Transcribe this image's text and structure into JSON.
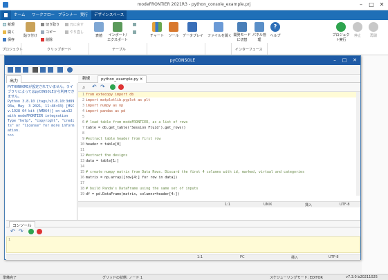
{
  "window": {
    "title": "modeFRONTIER 2021R3 - python_console_example.prj"
  },
  "ribbon_tabs": [
    "ホーム",
    "ワークフロー",
    "プランナー",
    "実行",
    "デザインスペース"
  ],
  "ribbon": {
    "project": {
      "new": "新規",
      "open": "開く",
      "save": "保存",
      "group": "プロジェクト"
    },
    "clipboard": {
      "paste": "貼り付け",
      "cut": "切り取り",
      "copy": "コピー",
      "remove": "削除",
      "undo": "元に戻す",
      "redo": "やり直し",
      "group": "クリップボード"
    },
    "table": {
      "table": "表値",
      "import": "インポート/エクスポート",
      "group": "テーブル"
    },
    "chart": "チャート",
    "tool": "ツール",
    "dataplay": "データプレイ",
    "fileopen": "ファイルを開く",
    "interface": {
      "switch": "開発モードに切替",
      "panel": "パネル管理",
      "group": "インターフェース"
    },
    "help": "ヘルプ",
    "run": "プロジェクト実行",
    "stop": "停止",
    "resume": "再開"
  },
  "dialog": {
    "title": "pyCONSOLE",
    "output_tab": "出力",
    "output_text": "PYTHONHOMEが設定されていません。ライブラリによってはpyCONSOLEから利用できません。\nPython 3.8.10 (tags/v3.8.10:3d8993a, May  3 2021, 11:48:03) [MSC v.1928 64 bit (AMD64)] on win32 with modeFRONTIER integration\nType \"help\", \"copyright\", \"credits\" or \"license\" for more information.\n>>>",
    "editor_tabs": [
      "新規",
      "python_example.py"
    ],
    "code_lines": [
      {
        "n": "1",
        "t": "from extecopy import db"
      },
      {
        "n": "2",
        "t": "import matplotlib.pyplot as plt"
      },
      {
        "n": "3",
        "t": "import numpy as np"
      },
      {
        "n": "4",
        "t": "import pandas as pd"
      },
      {
        "n": "5",
        "t": ""
      },
      {
        "n": "6",
        "t": "# load table from modeFRONTIER, as a list of rows"
      },
      {
        "n": "7",
        "t": "table = db.get_table('Session Fluid').get_rows()"
      },
      {
        "n": "8",
        "t": ""
      },
      {
        "n": "9",
        "t": "#extract table header from first row"
      },
      {
        "n": "10",
        "t": "header = table[0]"
      },
      {
        "n": "11",
        "t": ""
      },
      {
        "n": "12",
        "t": "#extract the designs"
      },
      {
        "n": "13",
        "t": "data = table[1:]"
      },
      {
        "n": "14",
        "t": ""
      },
      {
        "n": "15",
        "t": "# create numpy matrix from Data Rows. Discard the first 4 columns with id, marked, virtual and categories"
      },
      {
        "n": "16",
        "t": "matrix = np.array([row[4:] for row in data])"
      },
      {
        "n": "17",
        "t": ""
      },
      {
        "n": "18",
        "t": "# build Panda's DataFrame using the same set of inputs"
      },
      {
        "n": "19",
        "t": "df = pd.DataFrame(matrix, columns=header[4:])"
      }
    ],
    "editor_status": {
      "pos": "1:1",
      "eol": "UNIX",
      "mode": "挿入",
      "enc": "UTF-8"
    },
    "console_tab": "コンソール",
    "console_line": "1",
    "console_status": {
      "pos": "1:1",
      "eol": "PC",
      "mode": "挿入",
      "enc": "UTF-8"
    }
  },
  "status": {
    "left": "準備完了",
    "grid": "グリッドの状態: ノード 1",
    "mode": "スケジューリングモード: EDITOR",
    "version": "v7.3.0 b20211025"
  },
  "colors": {
    "ribbon": "#1f6fb7",
    "dialog_title": "#1e5aa5",
    "comment": "#6a8a4a",
    "keyword": "#b24d2a"
  }
}
